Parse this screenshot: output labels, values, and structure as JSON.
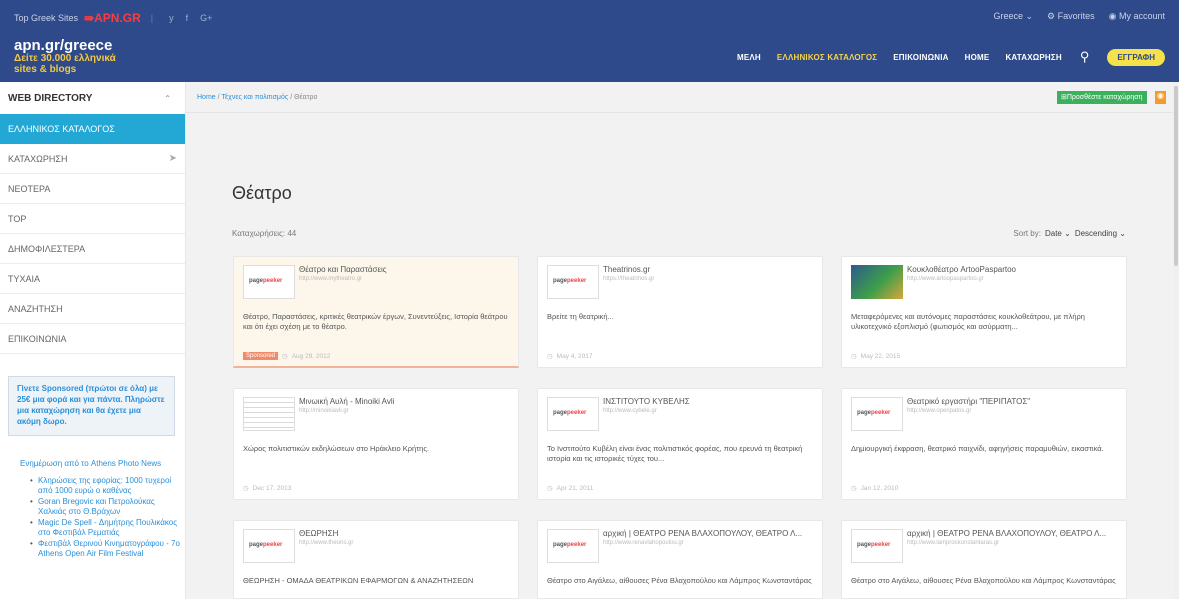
{
  "topbar": {
    "top_sites": "Top Greek Sites",
    "brand": "⇛APN.GR",
    "social": [
      "y",
      "f",
      "G+"
    ],
    "country": "Greece ⌄",
    "favorites": "Favorites",
    "account": "My account"
  },
  "logo": {
    "line1": "apn.gr/greece",
    "line2": "Δείτε 30.000 ελληνικά",
    "line3": "sites & blogs"
  },
  "nav": {
    "items": [
      "ΜΕΛΗ",
      "ΕΛΛΗΝΙΚΟΣ ΚΑΤΑΛΟΓΟΣ",
      "ΕΠΙΚΟΙΝΩΝΙΑ",
      "HOME",
      "ΚΑΤΑΧΩΡΗΣΗ"
    ],
    "active_index": 1,
    "register": "ΕΓΓΡΑΦΗ"
  },
  "sidebar": {
    "heading": "WEB DIRECTORY",
    "items": [
      {
        "label": "ΕΛΛΗΝΙΚΟΣ ΚΑΤΑΛΟΓΟΣ",
        "active": true
      },
      {
        "label": "ΚΑΤΑΧΩΡΗΣΗ",
        "icon": "paper-plane-icon"
      },
      {
        "label": "ΝΕΟΤΕΡΑ"
      },
      {
        "label": "TOP"
      },
      {
        "label": "ΔΗΜΟΦΙΛΕΣΤΕΡΑ"
      },
      {
        "label": "ΤΥΧΑΙΑ"
      },
      {
        "label": "ΑΝΑΖΗΤΗΣΗ"
      },
      {
        "label": "ΕΠΙΚΟΙΝΩΝΙΑ"
      }
    ],
    "promo": "Γίνετε Sponsored (πρώτοι σε όλα) με 25€ μια φορά και για πάντα. Πληρώστε μια καταχώρηση και θα έχετε μια ακόμη δωρο.",
    "news_title": "Ενημέρωση από το Athens Photo News",
    "news": [
      "Κληρώσεις της εφορίας: 1000 τυχεροί από 1000 ευρώ ο καθένας",
      "Goran Bregovic και Πετρολούκας Χαλκιάς στο Θ.Βράχων",
      "Magic De Spell - Δημήτρης Πουλικάκος στο Φεστιβάλ Ρεματιάς",
      "Φεστιβάλ Θερινού Κινηματογράφου - 7ο Athens Open Air Film Festival"
    ]
  },
  "breadcrumb": {
    "home": "Home",
    "sep": "/",
    "category": "Τέχνες και πολιτισμός",
    "current": "Θέατρο"
  },
  "add_listing": "Προσθέστε καταχώρηση",
  "page": {
    "title": "Θέατρο",
    "count": "Καταχωρήσεις: 44",
    "sort_label": "Sort by:",
    "sort_field": "Date ⌄",
    "sort_order": "Descending ⌄"
  },
  "cards": [
    {
      "title": "Θέατρο και Παραστάσεις",
      "url": "http://www.mytheatro.gr",
      "desc": "Θέατρο, Παραστάσεις, κριτικές θεατρικών έργων, Συνεντεύξεις, Ιστορία θεάτρου και ότι έχει σχέση με το θέατρο.",
      "date": "Aug 29, 2012",
      "badge": "Sponsored",
      "thumb": "pagepeeker"
    },
    {
      "title": "Theatrinos.gr",
      "url": "https://theatrinos.gr",
      "desc": "Βρείτε τη θεατρική...",
      "date": "May 4, 2017",
      "thumb": "pagepeeker"
    },
    {
      "title": "Κουκλοθέατρο ArtooPaspartoo",
      "url": "http://www.artoopaspartoo.gr",
      "desc": "Μεταφερόμενες και αυτόνομες παραστάσεις κουκλοθεάτρου, με πλήρη υλικοτεχνικό εξοπλισμό (φωτισμός και ασύρματη...",
      "date": "May 22, 2015",
      "thumb": "image"
    },
    {
      "title": "Μινωική Αυλή - Minoiki Avli",
      "url": "http://minoikiavli.gr",
      "desc": "Χώρος πολιτιστικών εκδηλώσεων στο Ηράκλειο Κρήτης.",
      "date": "Dec 17, 2013",
      "thumb": "doc"
    },
    {
      "title": "ΙΝΣΤΙΤΟΥΤΟ ΚΥΒΕΛΗΣ",
      "url": "http://www.cybele.gr",
      "desc": "Το Ινστιτούτο Κυβέλη είναι ένας πολιτιστικός φορέας, που ερευνά τη θεατρική ιστορία και τις ιστορικές τύχες του...",
      "date": "Apr 21, 2011",
      "thumb": "pagepeeker"
    },
    {
      "title": "Θεατρικό εργαστήρι \"ΠΕΡΙΠΑΤΟΣ\"",
      "url": "http://www.operipatos.gr",
      "desc": "Δημιουργική έκφραση, θεατρικό παιχνίδι, αφηγήσεις παραμυθιών, εικαστικά.",
      "date": "Jan 12, 2010",
      "thumb": "pagepeeker"
    },
    {
      "title": "ΘΕΩΡΗΣΗ",
      "url": "http://www.theoris.gr",
      "desc": "ΘΕΩΡΗΣΗ - ΟΜΑΔΑ ΘΕΑΤΡΙΚΩΝ ΕΦΑΡΜΟΓΩΝ & ΑΝΑΖΗΤΗΣΕΩΝ",
      "date": "",
      "thumb": "pagepeeker"
    },
    {
      "title": "αρχική | ΘΕΑΤΡΟ ΡΕΝΑ ΒΛΑΧΟΠΟΥΛΟΥ, ΘΕΑΤΡΟ Λ...",
      "url": "http://www.renavlahopoulou.gr",
      "desc": "Θέατρο στο Αιγάλεω, αίθουσες Ρένα Βλαχοπούλου και Λάμπρος Κωνσταντάρας",
      "date": "",
      "thumb": "pagepeeker"
    },
    {
      "title": "αρχική | ΘΕΑΤΡΟ ΡΕΝΑ ΒΛΑΧΟΠΟΥΛΟΥ, ΘΕΑΤΡΟ Λ...",
      "url": "http://www.lamproskonstantaras.gr",
      "desc": "Θέατρο στο Αιγάλεω, αίθουσες Ρένα Βλαχοπούλου και Λάμπρος Κωνσταντάρας",
      "date": "",
      "thumb": "pagepeeker"
    }
  ],
  "colors": {
    "header": "#2e4a8a",
    "accent": "#23a8d6",
    "brand_red": "#ff3b3b",
    "register": "#f5e14a"
  }
}
